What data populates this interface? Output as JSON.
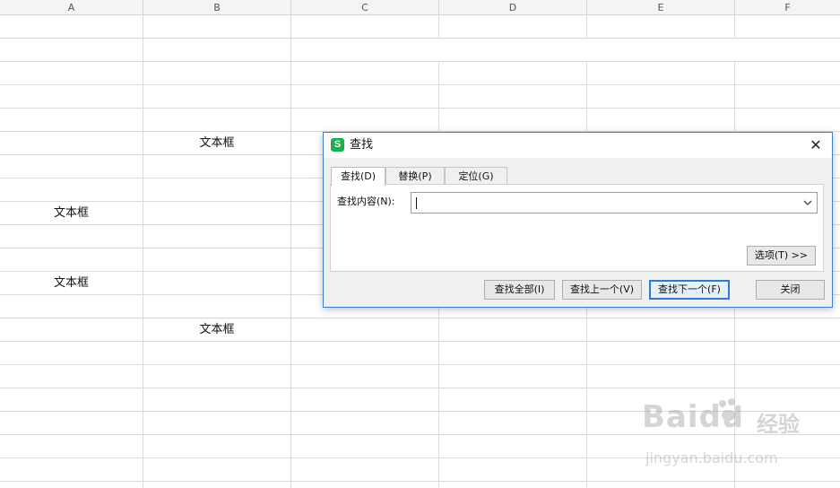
{
  "spreadsheet": {
    "columns": [
      "A",
      "B",
      "C",
      "D",
      "E",
      "F"
    ],
    "cells": {
      "b6": "文本框",
      "a9": "文本框",
      "a12": "文本框",
      "b14": "文本框"
    }
  },
  "dialog": {
    "title": "查找",
    "app_icon": "S",
    "close_glyph": "✕",
    "tabs": [
      {
        "label": "查找(D)",
        "active": true
      },
      {
        "label": "替换(P)",
        "active": false
      },
      {
        "label": "定位(G)",
        "active": false
      }
    ],
    "find_label": "查找内容(N):",
    "find_value": "",
    "options_label": "选项(T) >>",
    "buttons": {
      "find_all": "查找全部(I)",
      "find_prev": "查找上一个(V)",
      "find_next": "查找下一个(F)",
      "close": "关闭"
    }
  },
  "watermark": {
    "brand": "Baidu",
    "cn": "经验",
    "url": "jingyan.baidu.com"
  },
  "colors": {
    "accent": "#3c7fd0",
    "app_icon": "#17b14b",
    "grid": "#d9d9d9"
  }
}
